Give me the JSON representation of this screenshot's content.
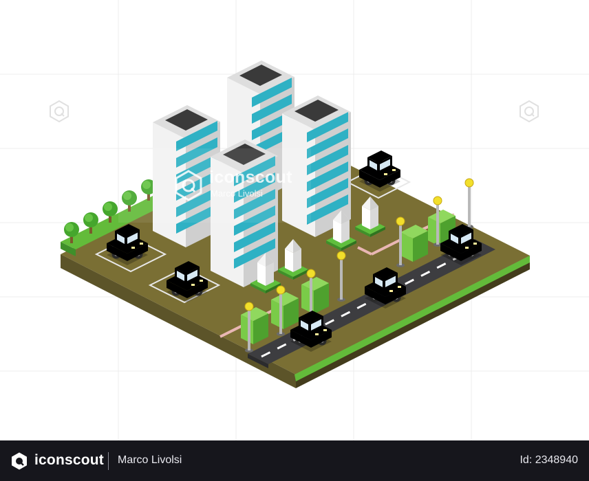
{
  "watermark": {
    "brand": "iconscout",
    "author": "Marco Livolsi"
  },
  "footer": {
    "brand": "iconscout",
    "author": "Marco Livolsi",
    "asset_id": "Id: 2348940"
  },
  "icons": {
    "brand_logo": "iconscout-logo-icon",
    "side_watermark": "iconscout-watermark-icon"
  },
  "colors": {
    "ground_top": "#7a6f34",
    "ground_side": "#4f4725",
    "grass": "#63bb3a",
    "road": "#3d3d40",
    "glass": "#2fb1c4",
    "building": "#e6e6e6",
    "car_orange": "#f07b2e",
    "car_yellow": "#e7d52a",
    "car_blue": "#2f43c8",
    "footer_bg": "#16161c"
  }
}
